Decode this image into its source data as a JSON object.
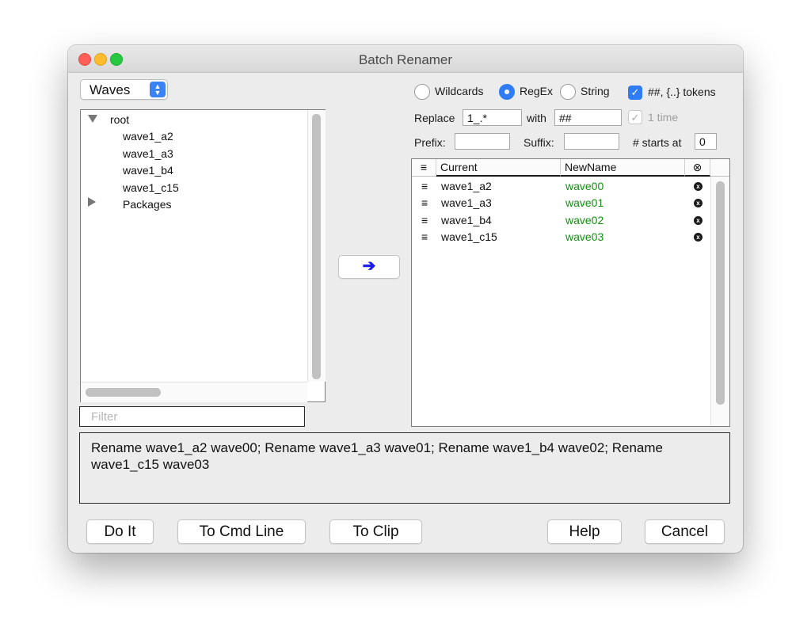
{
  "window": {
    "title": "Batch Renamer"
  },
  "source_popup": {
    "selected": "Waves"
  },
  "tree": {
    "root_label": "root",
    "children": [
      "wave1_a2",
      "wave1_a3",
      "wave1_b4",
      "wave1_c15"
    ],
    "folder_label": "Packages"
  },
  "filter": {
    "placeholder": "Filter",
    "value": ""
  },
  "mode": {
    "options": [
      "Wildcards",
      "RegEx",
      "String"
    ],
    "selected": "RegEx",
    "tokens_label": "##, {..} tokens",
    "tokens_checked": true
  },
  "replace": {
    "label": "Replace",
    "value": "1_.*",
    "with_label": "with",
    "with_value": "##",
    "once_label": "1 time",
    "once_checked": true
  },
  "prefix": {
    "label": "Prefix:",
    "value": ""
  },
  "suffix": {
    "label": "Suffix:",
    "value": ""
  },
  "starts_at": {
    "label": "# starts at",
    "value": "0"
  },
  "table": {
    "columns": [
      "≡",
      "Current",
      "NewName",
      "⊗"
    ],
    "rows": [
      {
        "handle": "≡",
        "current": "wave1_a2",
        "newname": "wave00",
        "remove": "x"
      },
      {
        "handle": "≡",
        "current": "wave1_a3",
        "newname": "wave01",
        "remove": "x"
      },
      {
        "handle": "≡",
        "current": "wave1_b4",
        "newname": "wave02",
        "remove": "x"
      },
      {
        "handle": "≡",
        "current": "wave1_c15",
        "newname": "wave03",
        "remove": "x"
      }
    ]
  },
  "transfer_button": {
    "glyph": "➔"
  },
  "command_text": "Rename wave1_a2 wave00; Rename wave1_a3 wave01; Rename wave1_b4 wave02; Rename wave1_c15 wave03",
  "buttons": {
    "do_it": "Do It",
    "to_cmd_line": "To Cmd Line",
    "to_clip": "To Clip",
    "help": "Help",
    "cancel": "Cancel"
  },
  "colors": {
    "accent": "#2f7cf6",
    "new_name": "#119211",
    "arrow": "#1a1aee"
  },
  "icons": [
    "popup-arrows-icon",
    "disclosure-open-icon",
    "disclosure-closed-icon",
    "right-arrow-icon",
    "drag-handle-icon",
    "remove-icon"
  ]
}
